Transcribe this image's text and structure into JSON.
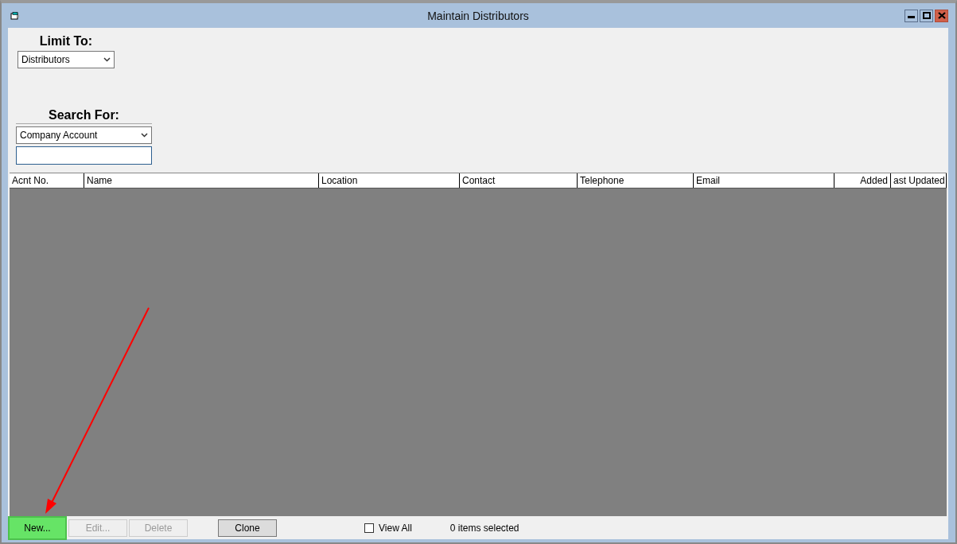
{
  "window": {
    "title": "Maintain Distributors"
  },
  "limit_to": {
    "label": "Limit To:",
    "value": "Distributors"
  },
  "search_for": {
    "label": "Search For:",
    "field": "Company Account"
  },
  "table": {
    "columns": [
      {
        "label": "Acnt No."
      },
      {
        "label": "Name"
      },
      {
        "label": "Location"
      },
      {
        "label": "Contact"
      },
      {
        "label": "Telephone"
      },
      {
        "label": "Email"
      },
      {
        "label": "Added"
      },
      {
        "label": "ast Updated"
      }
    ]
  },
  "buttons": [
    {
      "label": "New...",
      "disabled": false,
      "highlighted": true
    },
    {
      "label": "Edit...",
      "disabled": true,
      "highlighted": false
    },
    {
      "label": "Delete",
      "disabled": true,
      "highlighted": false
    },
    {
      "label": "Clone",
      "disabled": false,
      "highlighted": false
    }
  ],
  "view_all": {
    "label": "View All",
    "checked": false
  },
  "status": "0 items selected"
}
